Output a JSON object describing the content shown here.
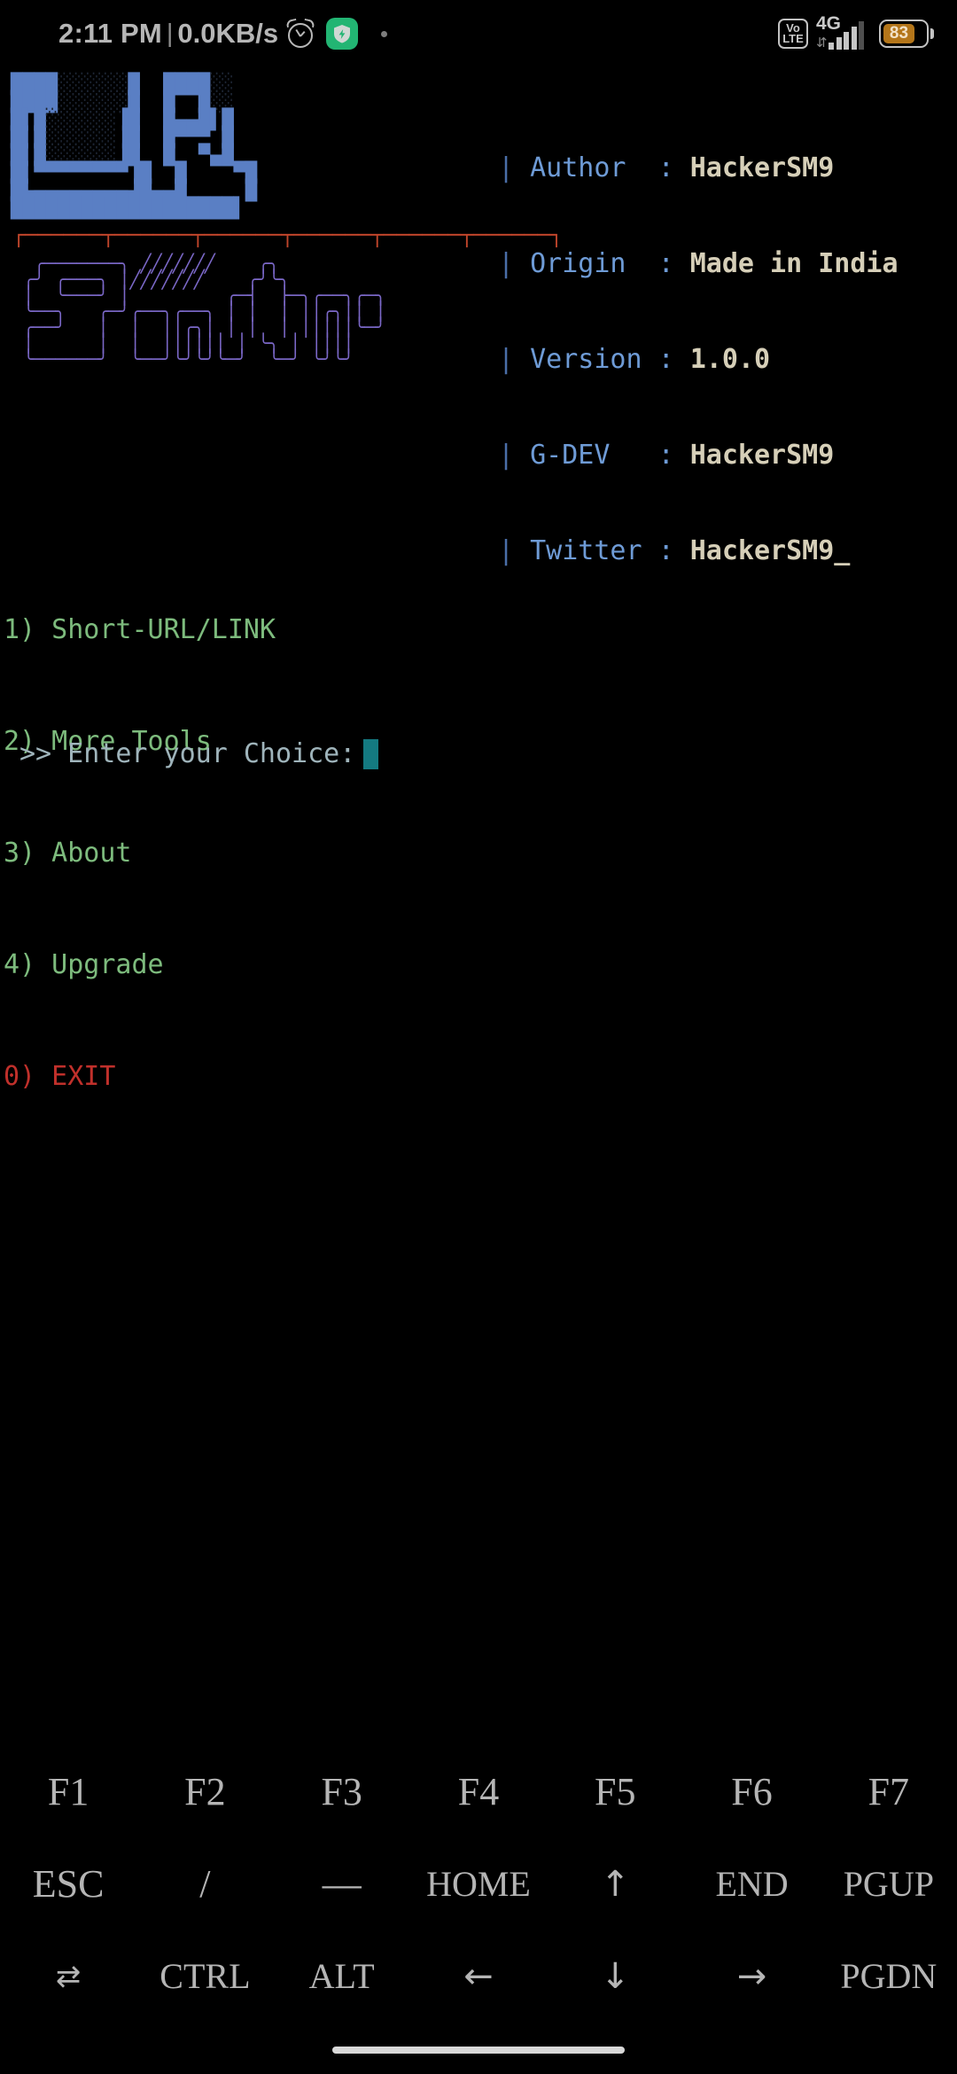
{
  "statusbar": {
    "time": "2:11 PM",
    "separator": "|",
    "network_speed": "0.0KB/s",
    "alarm_icon": "alarm-clock-icon",
    "security_icon": "shield-bolt-icon",
    "notification_dot": "notification-dot-icon",
    "volte_top": "Vo",
    "volte_bottom": "LTE",
    "network_type": "4G",
    "signal_icon": "signal-bars-icon",
    "battery_percent": "83",
    "battery_color": "#b4761a"
  },
  "logo": {
    "url_art_color": "#5a7fc4",
    "url_word": "URL",
    "separator_color": "#c0452b",
    "shortner_art_color": "#7b68c8",
    "shortner_word": "Shortner",
    "url_art": [
      "██      ▒▒▒▒▒▒▒▒  ██         ███████▌   ▒▒▒▒",
      "██▐▌    ▒▒▒▒▒▒▒▒ ▐▌██        ██    ▐██  ▒▒▒▒",
      "██▐▌    ▒▒▒▒▒▒▒▒ ▐▌██        ██  ▄▄  █▌ ▒▒▒▒",
      "██▐▌    ▒▒▒▒▒▒▒▒ ▐▌██        ██ ▐██▌ █▌▐████",
      "██▐▌    ▒▒▒▒▒▒▒▒ ▐▌██        ██  ▀▀  █▌ ▀▀▀█",
      "██▐▌    ▒▒▒▒▒▒▒▒ ▐▌██        ██      █▌    █",
      "██ ▀▀▀▀▀▀▀▀▀▀▀▀▀▀ ▐██        ██  ▀▀▀▀▀▀█▄  █",
      "███████████████████▌         ██       ▀███▌█"
    ],
    "separator_art": "┌──────┬──────┬──────┬──────┬──────┬──────┐",
    "shortner_art": [
      "    ╭───────╮  ╱╱╱╱╱╱╱      ╭╮",
      "   ╭╯ ╭───╮ │ ╱╱╱╱╱╱╱      ╭╯╰╮",
      "   │  │   │ │╱╱╱╱╱╱╱  ╭────┤  ├────╮╭───╮",
      "   │  ╰───╯ │ ╭──╮╭─╮ │ ╭╮ │  │ ╭╮ ││ ╭─╯",
      "   ╰──╮   ╭─╯ │  ││ │ │ ││ │  │ ││ ││ │",
      "      │   │   │  ││ ╰─╯ ╰╯ ╰──╯ ╰╯ ││ │",
      "   ╭──╯   │   │  ││ ╭──╮ ╭──╮ ╭──╮ ││ │",
      "   ╰──────╯   ╰──╯╰─╯  ╰─╯  ╰─╯  ╰─╯╰─╯"
    ]
  },
  "info": {
    "pipe": "|",
    "rows": [
      {
        "key": "Author ",
        "value": "HackerSM9"
      },
      {
        "key": "Origin ",
        "value": "Made in India"
      },
      {
        "key": "Version",
        "value": "1.0.0"
      },
      {
        "key": "G-DEV  ",
        "value": "HackerSM9"
      },
      {
        "key": "Twitter",
        "value": "HackerSM9_"
      }
    ]
  },
  "menu": {
    "items": [
      {
        "label": "1) Short-URL/LINK",
        "kind": "normal"
      },
      {
        "label": "2) More Tools",
        "kind": "normal"
      },
      {
        "label": "3) About",
        "kind": "normal"
      },
      {
        "label": "4) Upgrade",
        "kind": "normal"
      },
      {
        "label": "0) EXIT",
        "kind": "exit"
      }
    ],
    "normal_color": "#7dbb7d",
    "exit_color": "#c0302b"
  },
  "prompt": {
    "text": ">> Enter your Choice:",
    "value": "",
    "cursor_color": "#147a81"
  },
  "keyboard": {
    "row1": [
      "F1",
      "F2",
      "F3",
      "F4",
      "F5",
      "F6",
      "F7"
    ],
    "row2": [
      "ESC",
      "/",
      "—",
      "HOME",
      "↑",
      "END",
      "PGUP"
    ],
    "row3": [
      "⇄",
      "CTRL",
      "ALT",
      "←",
      "↓",
      "→",
      "PGDN"
    ]
  },
  "navbar": {
    "pill": "home-indicator"
  }
}
